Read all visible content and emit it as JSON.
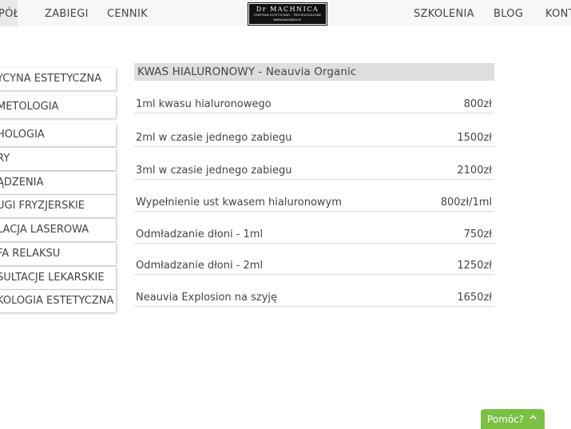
{
  "nav": {
    "items": [
      "PÓŁ",
      "ZABIEGI",
      "CENNIK",
      "SZKOLENIA",
      "BLOG",
      "KONT"
    ]
  },
  "logo": {
    "line1": "Dr MACHNICA",
    "line2": "CENTRUM ESTETYCZNO - TRYCHOLOGICZNE",
    "line3": "WWW.MACHNICA.PL"
  },
  "sidebar": {
    "items": [
      "YCYNA ESTETYCZNA",
      "METOLOGIA",
      "HOLOGIA",
      "RY",
      "ĄDZENIA",
      "UGI FRYZJERSKIE",
      "LACJA LASEROWA",
      "FA RELAKSU",
      "SULTACJE LEKARSKIE",
      "KOLOGIA ESTETYCZNA"
    ]
  },
  "prices": {
    "title": "KWAS HIALURONOWY - Neauvia Organic",
    "rows": [
      {
        "name": "1ml kwasu hialuronowego",
        "price": "800zł"
      },
      {
        "name": "2ml w czasie jednego zabiegu",
        "price": "1500zł"
      },
      {
        "name": "3ml w czasie jednego zabiegu",
        "price": "2100zł"
      },
      {
        "name": "Wypełnienie ust kwasem hialuronowym",
        "price": "800zł/1ml"
      },
      {
        "name": "Odmładzanie dłoni - 1ml",
        "price": "750zł"
      },
      {
        "name": "Odmładzanie dłoni - 2ml",
        "price": "1250zł"
      },
      {
        "name": "Neauvia Explosion na szyję",
        "price": "1650zł"
      }
    ]
  },
  "help": {
    "label": "Pomóc?",
    "icon": "chevron-up-icon"
  },
  "colors": {
    "help_bg": "#7ac143",
    "title_bg": "#dedede",
    "logo_bg": "#111111"
  }
}
